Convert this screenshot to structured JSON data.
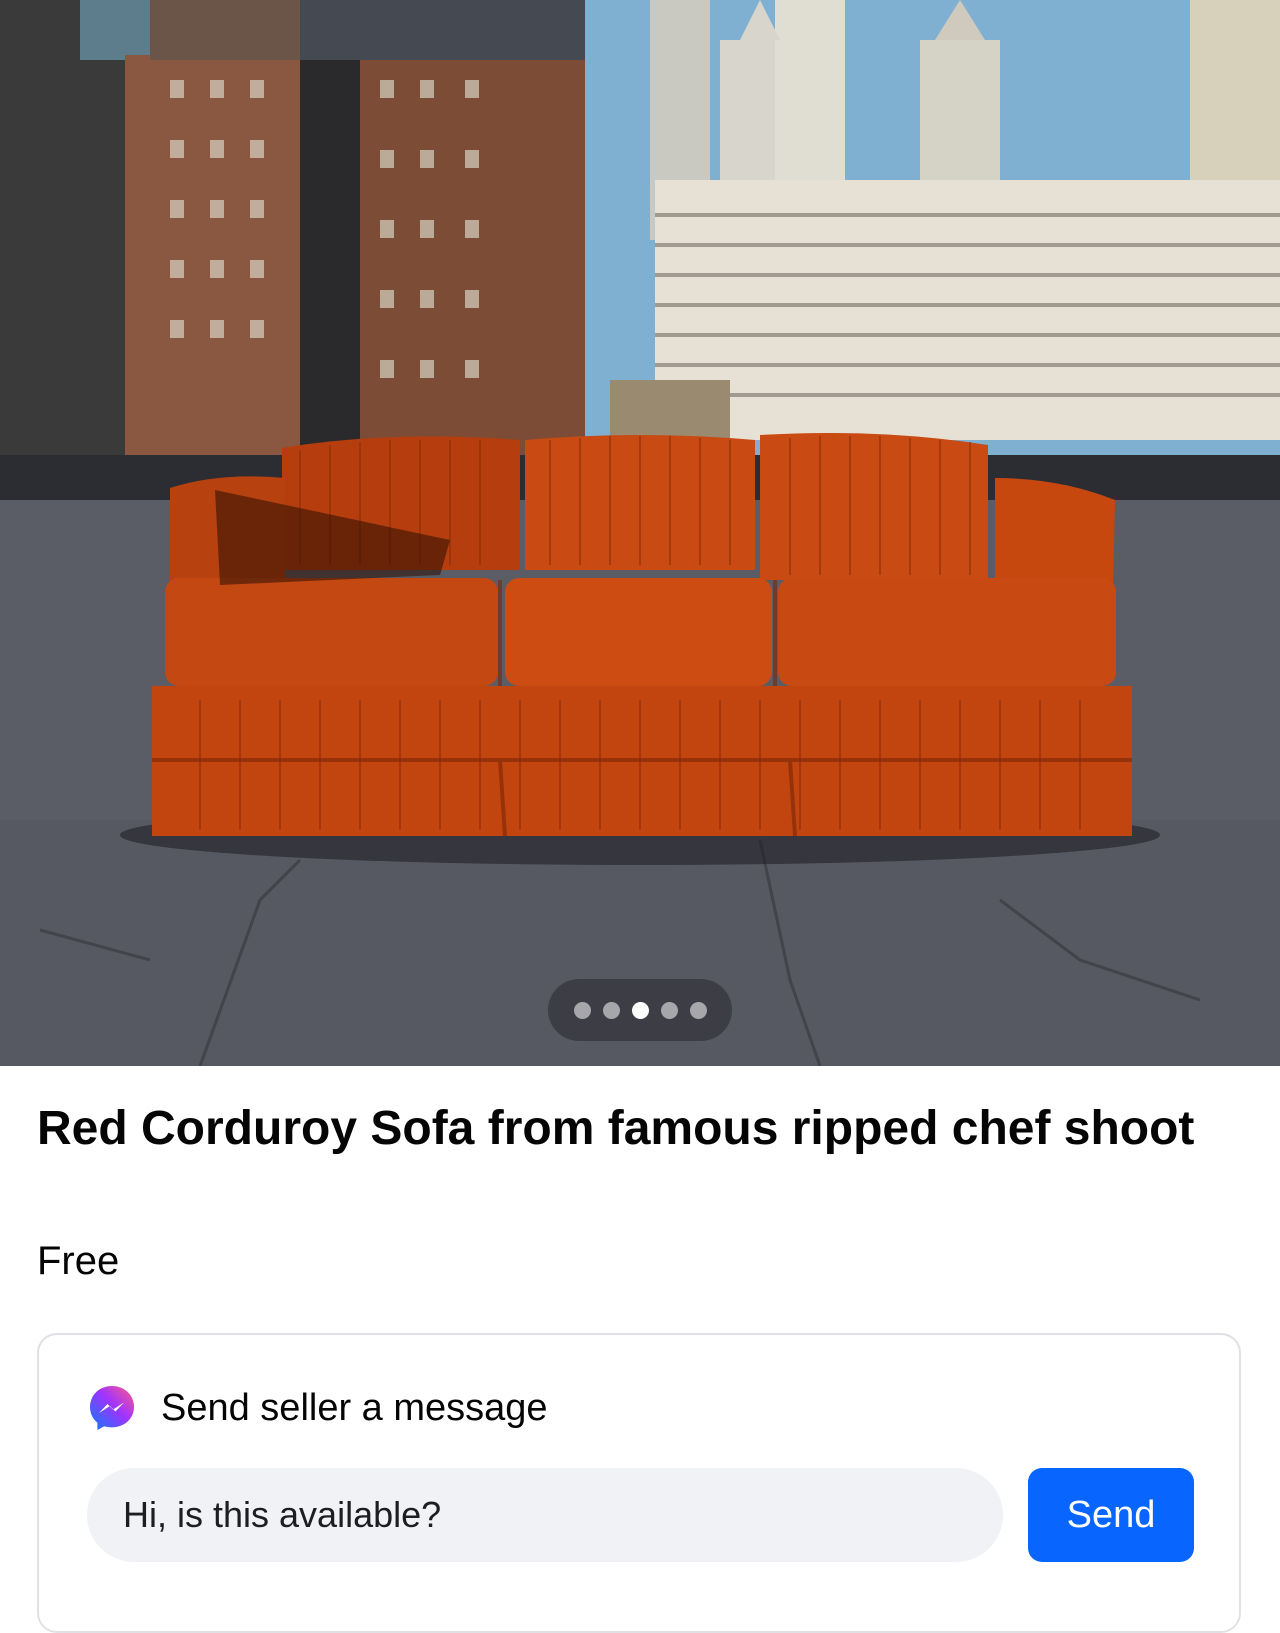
{
  "listing": {
    "title": "Red Corduroy Sofa from famous ripped chef shoot",
    "price": "Free",
    "photo_description_icon": "photo-of-orange-corduroy-sofa-on-rooftop",
    "carousel": {
      "count": 5,
      "active_index": 3
    }
  },
  "message": {
    "label": "Send seller a message",
    "input_value": "Hi, is this available?",
    "send_label": "Send",
    "icon": "messenger-icon"
  },
  "colors": {
    "send_button": "#0866ff",
    "input_bg": "#f0f2f5",
    "sofa": "#c94a12"
  }
}
